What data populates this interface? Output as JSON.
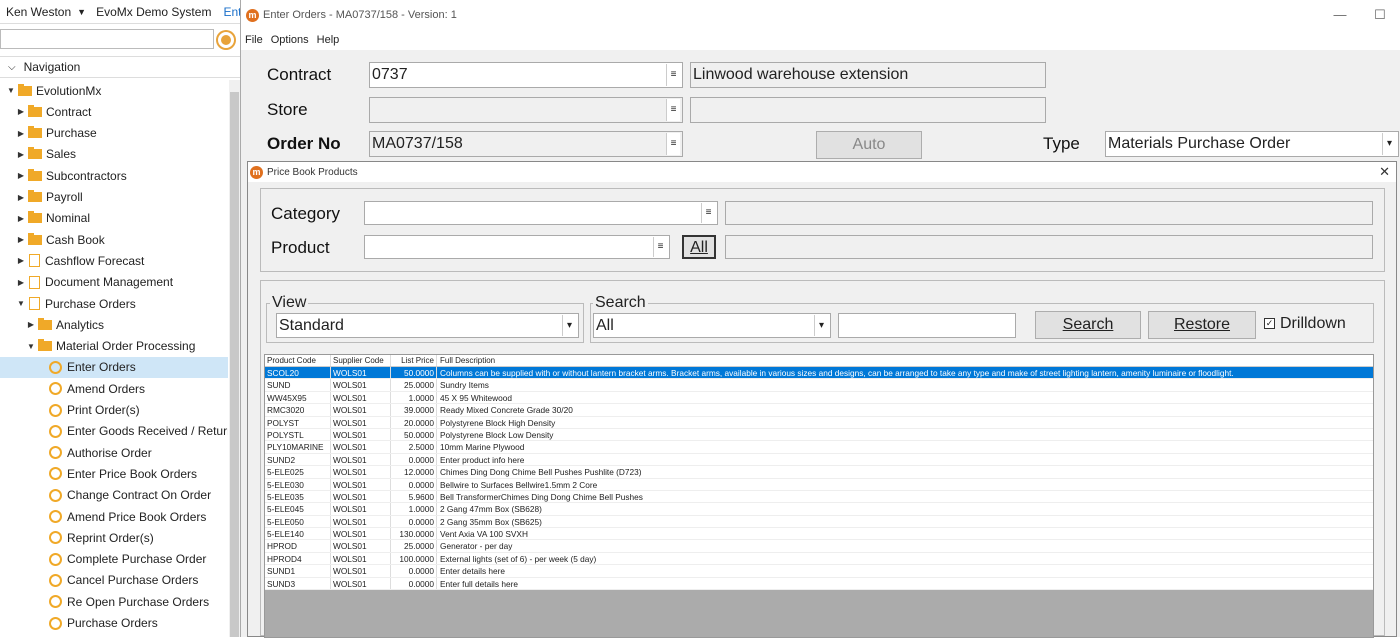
{
  "topbar": {
    "user": "Ken Weston",
    "system": "EvoMx Demo System",
    "link": "Enter"
  },
  "nav": {
    "header": "Navigation",
    "items": [
      {
        "label": "EvolutionMx",
        "icon": "folder",
        "level": 0,
        "arrow": "down"
      },
      {
        "label": "Contract",
        "icon": "folder",
        "level": 1,
        "arrow": "right"
      },
      {
        "label": "Purchase",
        "icon": "folder",
        "level": 1,
        "arrow": "right"
      },
      {
        "label": "Sales",
        "icon": "folder",
        "level": 1,
        "arrow": "right"
      },
      {
        "label": "Subcontractors",
        "icon": "folder",
        "level": 1,
        "arrow": "right"
      },
      {
        "label": "Payroll",
        "icon": "folder",
        "level": 1,
        "arrow": "right"
      },
      {
        "label": "Nominal",
        "icon": "folder",
        "level": 1,
        "arrow": "right"
      },
      {
        "label": "Cash Book",
        "icon": "folder",
        "level": 1,
        "arrow": "right"
      },
      {
        "label": "Cashflow Forecast",
        "icon": "doc",
        "level": 1,
        "arrow": "right"
      },
      {
        "label": "Document Management",
        "icon": "doc",
        "level": 1,
        "arrow": "right"
      },
      {
        "label": "Purchase Orders",
        "icon": "doc",
        "level": 1,
        "arrow": "down"
      },
      {
        "label": "Analytics",
        "icon": "folder",
        "level": 2,
        "arrow": "right"
      },
      {
        "label": "Material Order Processing",
        "icon": "folder",
        "level": 2,
        "arrow": "down"
      },
      {
        "label": "Enter Orders",
        "icon": "ring",
        "level": 3,
        "arrow": "",
        "selected": true
      },
      {
        "label": "Amend Orders",
        "icon": "ring",
        "level": 3,
        "arrow": ""
      },
      {
        "label": "Print Order(s)",
        "icon": "ring",
        "level": 3,
        "arrow": ""
      },
      {
        "label": "Enter Goods Received / Returned",
        "icon": "ring",
        "level": 3,
        "arrow": ""
      },
      {
        "label": "Authorise Order",
        "icon": "ring",
        "level": 3,
        "arrow": ""
      },
      {
        "label": "Enter Price Book Orders",
        "icon": "ring",
        "level": 3,
        "arrow": ""
      },
      {
        "label": "Change Contract On Order",
        "icon": "ring",
        "level": 3,
        "arrow": ""
      },
      {
        "label": "Amend Price Book Orders",
        "icon": "ring",
        "level": 3,
        "arrow": ""
      },
      {
        "label": "Reprint Order(s)",
        "icon": "ring",
        "level": 3,
        "arrow": ""
      },
      {
        "label": "Complete Purchase Order",
        "icon": "ring",
        "level": 3,
        "arrow": ""
      },
      {
        "label": "Cancel Purchase Orders",
        "icon": "ring",
        "level": 3,
        "arrow": ""
      },
      {
        "label": "Re Open Purchase Orders",
        "icon": "ring",
        "level": 3,
        "arrow": ""
      },
      {
        "label": "Purchase Orders",
        "icon": "ring",
        "level": 3,
        "arrow": ""
      }
    ]
  },
  "window": {
    "title": "Enter Orders - MA0737/158 - Version: 1",
    "menu": [
      "File",
      "Options",
      "Help"
    ],
    "controls": {
      "min": "—",
      "max": "☐"
    }
  },
  "form": {
    "contract_label": "Contract",
    "contract_value": "0737",
    "contract_desc": "Linwood warehouse extension",
    "store_label": "Store",
    "store_value": "",
    "store_desc": "",
    "order_label": "Order No",
    "order_value": "MA0737/158",
    "auto_label": "Auto",
    "type_label": "Type",
    "type_value": "Materials Purchase Order"
  },
  "dialog": {
    "title": "Price Book Products",
    "close": "✕",
    "category_label": "Category",
    "category_value": "",
    "category_desc": "",
    "product_label": "Product",
    "product_value": "",
    "all_label": "All",
    "product_desc": "",
    "view_legend": "View",
    "view_value": "Standard",
    "search_legend": "Search",
    "search_scope": "All",
    "search_text": "",
    "search_btn": "Search",
    "restore_btn": "Restore",
    "drilldown_label": "Drilldown",
    "drilldown_checked": true
  },
  "grid": {
    "columns": [
      "Product Code",
      "Supplier Code",
      "List Price",
      "Full Description"
    ],
    "rows": [
      [
        "SCOL20",
        "WOLS01",
        "50.0000",
        "Columns can be supplied with or without lantern bracket arms. Bracket arms, available in various sizes and designs, can be arranged to take any type and make of street lighting lantern, amenity luminaire or floodlight."
      ],
      [
        "SUND",
        "WOLS01",
        "25.0000",
        "Sundry Items"
      ],
      [
        "WW45X95",
        "WOLS01",
        "1.0000",
        "45 X 95 Whitewood"
      ],
      [
        "RMC3020",
        "WOLS01",
        "39.0000",
        "Ready Mixed Concrete Grade 30/20"
      ],
      [
        "POLYST",
        "WOLS01",
        "20.0000",
        "Polystyrene Block High Density"
      ],
      [
        "POLYSTL",
        "WOLS01",
        "50.0000",
        "Polystyrene Block Low Density"
      ],
      [
        "PLY10MARINE",
        "WOLS01",
        "2.5000",
        "10mm Marine Plywood"
      ],
      [
        "SUND2",
        "WOLS01",
        "0.0000",
        "Enter product info here"
      ],
      [
        "5-ELE025",
        "WOLS01",
        "12.0000",
        "Chimes Ding Dong Chime Bell Pushes Pushlite (D723)"
      ],
      [
        "5-ELE030",
        "WOLS01",
        "0.0000",
        "Bellwire to Surfaces Bellwire1.5mm 2 Core"
      ],
      [
        "5-ELE035",
        "WOLS01",
        "5.9600",
        "Bell TransformerChimes Ding Dong Chime Bell Pushes"
      ],
      [
        "5-ELE045",
        "WOLS01",
        "1.0000",
        "2 Gang 47mm Box (SB628)"
      ],
      [
        "5-ELE050",
        "WOLS01",
        "0.0000",
        "2 Gang 35mm Box (SB625)"
      ],
      [
        "5-ELE140",
        "WOLS01",
        "130.0000",
        "Vent Axia    VA 100 SVXH"
      ],
      [
        "HPROD",
        "WOLS01",
        "25.0000",
        "Generator - per day"
      ],
      [
        "HPROD4",
        "WOLS01",
        "100.0000",
        "External lights (set of 6) - per week (5 day)"
      ],
      [
        "SUND1",
        "WOLS01",
        "0.0000",
        "Enter details here"
      ],
      [
        "SUND3",
        "WOLS01",
        "0.0000",
        "Enter full details here"
      ]
    ],
    "selected_row": 0
  }
}
